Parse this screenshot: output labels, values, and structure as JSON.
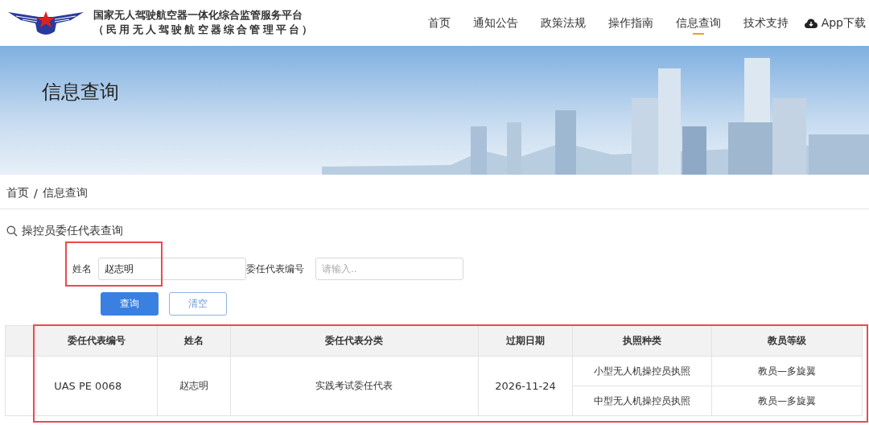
{
  "header": {
    "title": "国家无人驾驶航空器一体化综合监管服务平台",
    "subtitle": "（民用无人驾驶航空器综合管理平台）"
  },
  "nav": [
    {
      "label": "首页",
      "selected": false
    },
    {
      "label": "通知公告",
      "selected": false
    },
    {
      "label": "政策法规",
      "selected": false
    },
    {
      "label": "操作指南",
      "selected": false
    },
    {
      "label": "信息查询",
      "selected": true
    },
    {
      "label": "技术支持",
      "selected": false
    }
  ],
  "app_download": "App下载",
  "banner": {
    "kind": "picture",
    "title": "信息查询"
  },
  "breadcrumb": [
    "首页",
    "信息查询"
  ],
  "breadcrumb_separator": "/",
  "section_title": "操控员委任代表查询",
  "filters": [
    {
      "label": "姓名",
      "value": "赵志明",
      "highlighted": true
    },
    {
      "label": "委任代表编号",
      "placeholder": "请输入.."
    }
  ],
  "buttons": [
    {
      "label": "查询",
      "kind": "primary"
    },
    {
      "label": "清空",
      "kind": "plain"
    }
  ],
  "table": {
    "highlighted": true,
    "columns": [
      "委任代表编号",
      "姓名",
      "委任代表分类",
      "过期日期",
      "执照种类",
      "教员等级"
    ],
    "rows": [
      {
        "code": "UAS PE 0068",
        "name": "赵志明",
        "category": "实践考试委任代表",
        "expiry": "2026-11-24",
        "licenses": [
          {
            "type": "小型无人机操控员执照",
            "level": "教员—多旋翼"
          },
          {
            "type": "中型无人机操控员执照",
            "level": "教员—多旋翼"
          }
        ]
      }
    ]
  }
}
